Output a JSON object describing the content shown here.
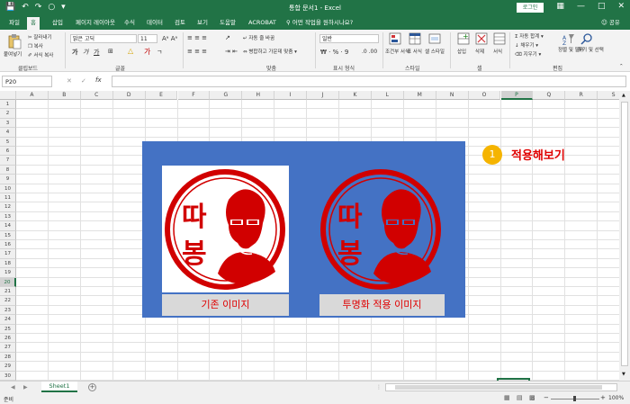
{
  "window": {
    "title": "통합 문서1  -  Excel",
    "login_label": "로그인"
  },
  "tabs": [
    {
      "label": "파일"
    },
    {
      "label": "홈"
    },
    {
      "label": "삽입"
    },
    {
      "label": "페이지 레이아웃"
    },
    {
      "label": "수식"
    },
    {
      "label": "데이터"
    },
    {
      "label": "검토"
    },
    {
      "label": "보기"
    },
    {
      "label": "도움말"
    },
    {
      "label": "ACROBAT"
    }
  ],
  "tell_me": "어떤 작업을 원하시나요?",
  "share": "공유",
  "ribbon": {
    "clipboard": {
      "paste": "붙여넣기",
      "cut": "잘라내기",
      "copy": "복사",
      "format_painter": "서식 복사",
      "label": "클립보드"
    },
    "font": {
      "name": "맑은 고딕",
      "size": "11",
      "label": "글꼴"
    },
    "alignment": {
      "wrap": "자동 줄 바꿈",
      "merge": "병합하고 가운데 맞춤",
      "label": "맞춤"
    },
    "number": {
      "format": "일반",
      "label": "표시 형식"
    },
    "styles": {
      "conditional": "조건부 서식",
      "table": "표 서식",
      "cell": "셀 스타일",
      "label": "스타일"
    },
    "cells": {
      "insert": "삽입",
      "delete": "삭제",
      "format": "서식",
      "label": "셀"
    },
    "editing": {
      "autosum": "자동 합계",
      "fill": "채우기",
      "clear": "지우기",
      "sort": "정렬 및 필터",
      "find": "찾기 및 선택",
      "label": "편집"
    }
  },
  "formula_bar": {
    "name_box": "P20",
    "value": ""
  },
  "columns": [
    "A",
    "B",
    "C",
    "D",
    "E",
    "F",
    "G",
    "H",
    "I",
    "J",
    "K",
    "L",
    "M",
    "N",
    "O",
    "P",
    "Q",
    "R",
    "S"
  ],
  "rows": [
    "1",
    "2",
    "3",
    "4",
    "5",
    "6",
    "7",
    "8",
    "9",
    "10",
    "11",
    "12",
    "13",
    "14",
    "15",
    "16",
    "17",
    "18",
    "19",
    "20",
    "21",
    "22",
    "23",
    "24",
    "25",
    "26",
    "27",
    "28",
    "29",
    "30"
  ],
  "selected_cell": "P20",
  "panel": {
    "background": "#4472c4",
    "left_caption": "기존 이미지",
    "right_caption": "투명화 적용 이미지",
    "stamp_char_top": "따",
    "stamp_char_bottom": "봉"
  },
  "callout": {
    "number": "1",
    "text": "적용해보기"
  },
  "sheet": {
    "name": "Sheet1"
  },
  "status": {
    "ready": "준비",
    "zoom": "100%"
  },
  "colors": {
    "excel_green": "#217346",
    "stamp_red": "#d10000",
    "badge": "#f5b400"
  }
}
